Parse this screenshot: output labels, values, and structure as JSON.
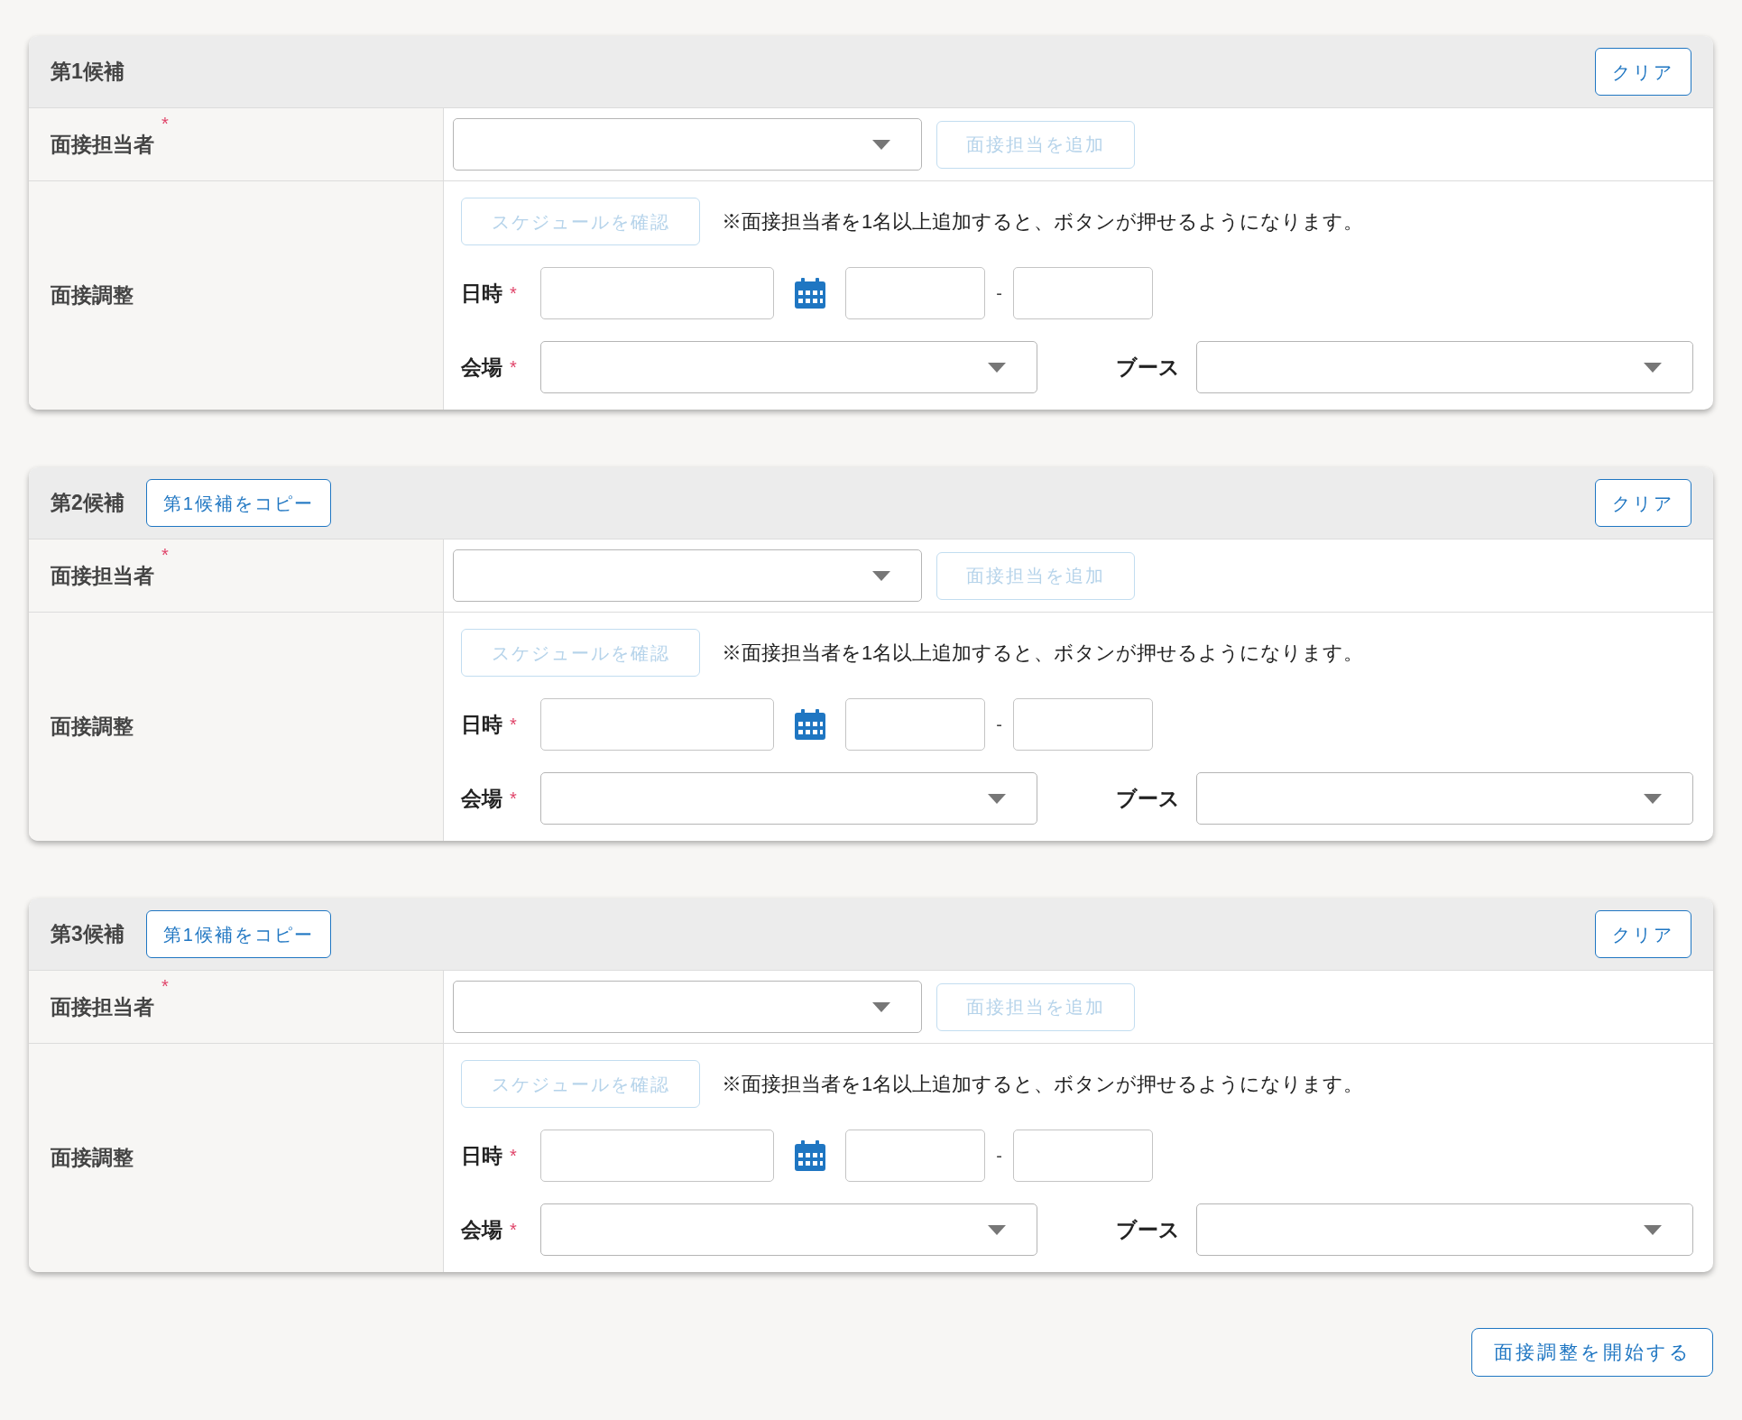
{
  "candidates": [
    {
      "title": "第1候補",
      "clear_button": "クリア",
      "interviewer": {
        "label": "面接担当者",
        "required_mark": "*",
        "add_button": {
          "label": "面接担当を追加",
          "disabled": true
        }
      },
      "adjustment": {
        "label": "面接調整",
        "schedule_button": {
          "label": "スケジュールを確認",
          "disabled": true
        },
        "note": "※面接担当者を1名以上追加すると、ボタンが押せるようになります。",
        "datetime_label": "日時",
        "datetime_required_mark": "*",
        "time_separator": "-",
        "venue_label": "会場",
        "venue_required_mark": "*",
        "booth_label": "ブース"
      }
    },
    {
      "title": "第2候補",
      "copy_button": "第1候補をコピー",
      "clear_button": "クリア",
      "interviewer": {
        "label": "面接担当者",
        "required_mark": "*",
        "add_button": {
          "label": "面接担当を追加",
          "disabled": true
        }
      },
      "adjustment": {
        "label": "面接調整",
        "schedule_button": {
          "label": "スケジュールを確認",
          "disabled": true
        },
        "note": "※面接担当者を1名以上追加すると、ボタンが押せるようになります。",
        "datetime_label": "日時",
        "datetime_required_mark": "*",
        "time_separator": "-",
        "venue_label": "会場",
        "venue_required_mark": "*",
        "booth_label": "ブース"
      }
    },
    {
      "title": "第3候補",
      "copy_button": "第1候補をコピー",
      "clear_button": "クリア",
      "interviewer": {
        "label": "面接担当者",
        "required_mark": "*",
        "add_button": {
          "label": "面接担当を追加",
          "disabled": true
        }
      },
      "adjustment": {
        "label": "面接調整",
        "schedule_button": {
          "label": "スケジュールを確認",
          "disabled": true
        },
        "note": "※面接担当者を1名以上追加すると、ボタンが押せるようになります。",
        "datetime_label": "日時",
        "datetime_required_mark": "*",
        "time_separator": "-",
        "venue_label": "会場",
        "venue_required_mark": "*",
        "booth_label": "ブース"
      }
    }
  ],
  "submit_button": "面接調整を開始する"
}
